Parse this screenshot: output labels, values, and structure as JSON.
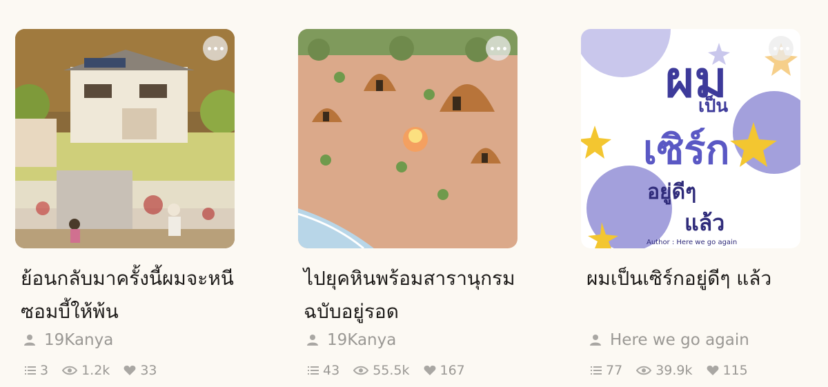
{
  "cards": [
    {
      "title": "ย้อนกลับมาครั้งนี้ผมจะหนีซอมบี้ให้พ้น",
      "author": "19Kanya",
      "chapters": "3",
      "views": "1.2k",
      "likes": "33"
    },
    {
      "title": "ไปยุคหินพร้อมสารานุกรมฉบับอยู่รอด",
      "author": "19Kanya",
      "chapters": "43",
      "views": "55.5k",
      "likes": "167"
    },
    {
      "title": "ผมเป็นเซิร์กอยู่ดีๆ แล้ว",
      "author": "Here we go again",
      "chapters": "77",
      "views": "39.9k",
      "likes": "115",
      "cover_text": {
        "line1": "ผม",
        "line2": "เป็น",
        "line3": "เซิร์ก",
        "line4": "อยู่ดีๆ",
        "line5": "แล้ว",
        "credit": "Author : Here we go again"
      }
    }
  ],
  "icons": {
    "more": "more-icon",
    "author": "user-icon",
    "chapters": "list-icon",
    "views": "eye-icon",
    "likes": "heart-icon"
  }
}
